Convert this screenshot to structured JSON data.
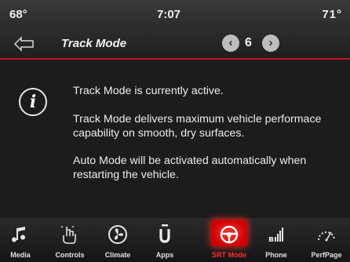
{
  "status": {
    "temp_left": "68°",
    "clock": "7:07",
    "temp_right": "71°"
  },
  "header": {
    "title": "Track Mode",
    "page_number": "6"
  },
  "content": {
    "line1": "Track Mode is currently active.",
    "line2": "Track Mode delivers maximum vehicle performace capability on smooth, dry surfaces.",
    "line3": "Auto Mode will be activated automatically when restarting the vehicle."
  },
  "dock": {
    "items": [
      {
        "label": "Media",
        "icon": "music-note-icon"
      },
      {
        "label": "Controls",
        "icon": "hand-touch-icon"
      },
      {
        "label": "Climate",
        "icon": "fan-icon"
      },
      {
        "label": "Apps",
        "icon": "apps-icon"
      },
      {
        "label": "SRT Mode",
        "icon": "steering-wheel-icon",
        "active": true
      },
      {
        "label": "Phone",
        "icon": "phone-signal-icon"
      },
      {
        "label": "PerfPage",
        "icon": "perf-page-icon"
      }
    ]
  },
  "colors": {
    "accent": "#c0181e",
    "active": "#ff3030"
  }
}
